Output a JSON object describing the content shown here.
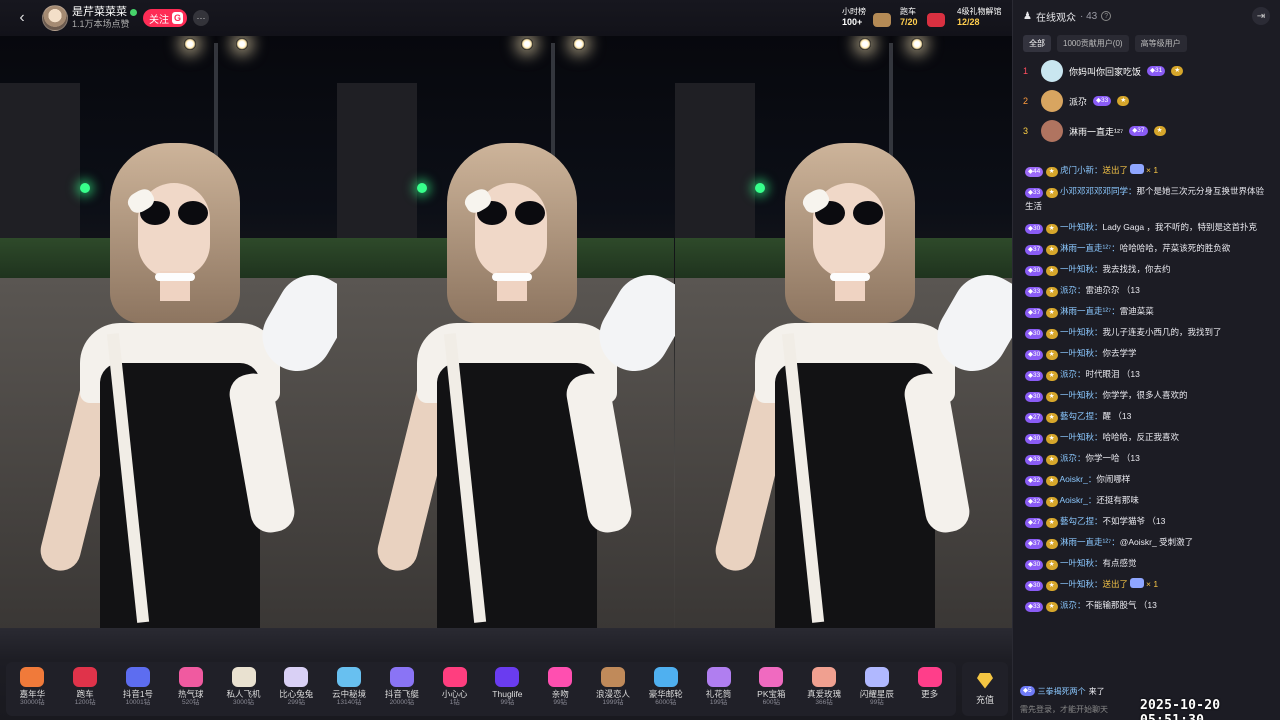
{
  "header": {
    "host_name": "是芹菜菜菜",
    "host_likes": "1.1万本场点赞",
    "follow_label": "关注",
    "follow_badge": "G",
    "more_label": "···",
    "back_label": "‹"
  },
  "rankings": [
    {
      "label": "小时榜",
      "value": "100+"
    },
    {
      "label": "跑车",
      "value": "7/20"
    },
    {
      "label": "4级礼物解馆",
      "value": "12/28"
    }
  ],
  "gifts": [
    {
      "name": "嘉年华",
      "price": "30000钻",
      "color": "#f07a3a",
      "icon": "carnival-icon"
    },
    {
      "name": "跑车",
      "price": "1200钻",
      "color": "#e0334a",
      "icon": "sports-car-icon"
    },
    {
      "name": "抖音1号",
      "price": "10001钻",
      "color": "#5d6df0",
      "icon": "rocket-icon"
    },
    {
      "name": "热气球",
      "price": "520钻",
      "color": "#f05aa0",
      "icon": "hot-air-balloon-icon"
    },
    {
      "name": "私人飞机",
      "price": "3000钻",
      "color": "#e9e1d0",
      "icon": "airplane-icon"
    },
    {
      "name": "比心兔兔",
      "price": "299钻",
      "color": "#d9d0f5",
      "icon": "bunny-icon"
    },
    {
      "name": "云中秘境",
      "price": "13140钻",
      "color": "#68c0f0",
      "icon": "cloud-castle-icon"
    },
    {
      "name": "抖音飞艇",
      "price": "20000钻",
      "color": "#8a74f5",
      "icon": "airship-icon"
    },
    {
      "name": "小心心",
      "price": "1钻",
      "color": "#ff3e7f",
      "icon": "heart-icon"
    },
    {
      "name": "Thuglife",
      "price": "99钻",
      "color": "#6a3cf0",
      "icon": "sunglasses-icon"
    },
    {
      "name": "亲吻",
      "price": "99钻",
      "color": "#ff4fb0",
      "icon": "kiss-icon"
    },
    {
      "name": "浪漫恋人",
      "price": "1999钻",
      "color": "#c08a5a",
      "icon": "bicycle-icon"
    },
    {
      "name": "豪华邮轮",
      "price": "6000钻",
      "color": "#4fb0f0",
      "icon": "cruise-ship-icon"
    },
    {
      "name": "礼花筒",
      "price": "199钻",
      "color": "#b07ef0",
      "icon": "confetti-icon"
    },
    {
      "name": "PK宝箱",
      "price": "600钻",
      "color": "#f06ac0",
      "icon": "treasure-box-icon"
    },
    {
      "name": "真爱玫瑰",
      "price": "366钻",
      "color": "#f0a090",
      "icon": "rose-icon"
    },
    {
      "name": "闪耀星辰",
      "price": "99钻",
      "color": "#b0b8ff",
      "icon": "star-icon"
    },
    {
      "name": "更多",
      "price": "",
      "color": "#ff3e8a",
      "icon": "gift-box-icon"
    }
  ],
  "recharge_label": "充值",
  "audience": {
    "title": "在线观众",
    "count": "· 43",
    "help": "?",
    "tabs": [
      "全部",
      "1000贡献用户(0)",
      "高等级用户"
    ],
    "top": [
      {
        "rank": "1",
        "name": "你妈叫你回家吃饭",
        "level": "31",
        "color": "#c9e6f0"
      },
      {
        "rank": "2",
        "name": "派尕",
        "level": "33",
        "color": "#d8a560"
      },
      {
        "rank": "3",
        "name": "淋雨一直走¹²⁷",
        "level": "37",
        "color": "#b07460"
      }
    ]
  },
  "chat": [
    {
      "level": "44",
      "name": "虎门小新：",
      "text": "送出了",
      "gift": true,
      "tail": "× 1"
    },
    {
      "level": "33",
      "name": "小邓邓邓邓邓同学：",
      "text": "那个是她三次元分身互换世界体验生活"
    },
    {
      "level": "30",
      "name": "一叶知秋：",
      "text": "Lady Gaga ，我不听的，特别是这首扑克"
    },
    {
      "level": "37",
      "name": "淋雨一直走¹²⁷：",
      "text": "哈哈哈哈，芹菜该死的胜负欲"
    },
    {
      "level": "30",
      "name": "一叶知秋：",
      "text": "我去找找，你去约"
    },
    {
      "level": "33",
      "name": "派尕：",
      "text": "雷迪尕尕 （13"
    },
    {
      "level": "37",
      "name": "淋雨一直走¹²⁷：",
      "text": "雷迪菜菜"
    },
    {
      "level": "30",
      "name": "一叶知秋：",
      "text": "我儿子连麦小西几的，我找到了"
    },
    {
      "level": "30",
      "name": "一叶知秋：",
      "text": "你去学学"
    },
    {
      "level": "33",
      "name": "派尕：",
      "text": "时代眼泪 （13"
    },
    {
      "level": "30",
      "name": "一叶知秋：",
      "text": "你学学，很多人喜欢的"
    },
    {
      "level": "27",
      "name": "藝勾乙捏：",
      "text": "醒 （13"
    },
    {
      "level": "30",
      "name": "一叶知秋：",
      "text": "哈哈哈，反正我喜欢"
    },
    {
      "level": "33",
      "name": "派尕：",
      "text": "你学一哈 （13"
    },
    {
      "level": "32",
      "name": "Aoiskr_：",
      "text": "你闹哪样"
    },
    {
      "level": "32",
      "name": "Aoiskr_：",
      "text": "还挺有那味"
    },
    {
      "level": "27",
      "name": "藝勾乙捏：",
      "text": "不如学猫爷 （13"
    },
    {
      "level": "37",
      "name": "淋雨一直走¹²⁷：",
      "text": "@Aoiskr_ 受刺激了"
    },
    {
      "level": "30",
      "name": "一叶知秋：",
      "text": "有点感觉"
    },
    {
      "level": "30",
      "name": "一叶知秋：",
      "text": "送出了",
      "gift": true,
      "tail": "× 1"
    },
    {
      "level": "33",
      "name": "派尕：",
      "text": "不能输那股气 （13"
    }
  ],
  "entry": {
    "level": "5",
    "name": "三拳揭死两个",
    "text": "来了"
  },
  "input_hint": "需先登录，才能开始聊天",
  "timestamp": "2025-10-20 05:51:30"
}
